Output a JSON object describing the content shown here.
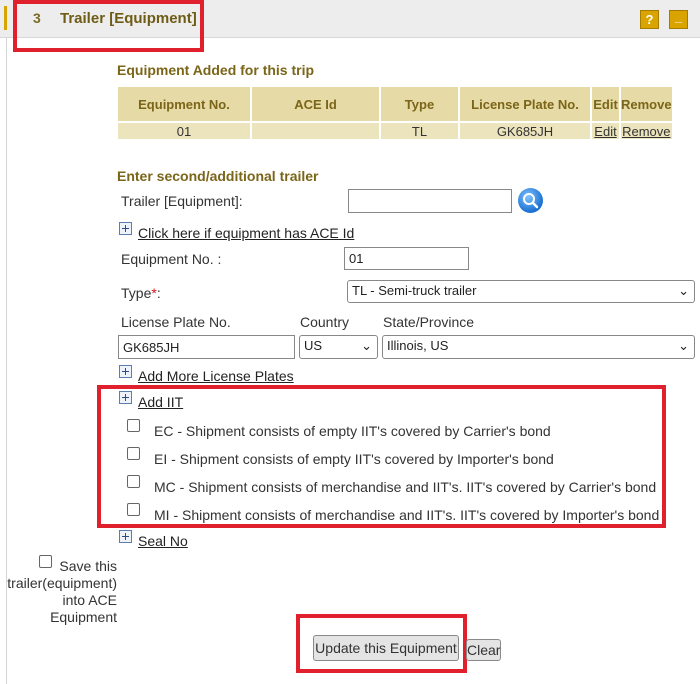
{
  "header": {
    "number": "3",
    "title": "Trailer [Equipment]",
    "help_label": "?",
    "minimize_label": "_"
  },
  "equipment_added": {
    "title": "Equipment Added for this trip",
    "columns": [
      "Equipment No.",
      "ACE Id",
      "Type",
      "License Plate No.",
      "Edit",
      "Remove"
    ],
    "rows": [
      {
        "equipment_no": "01",
        "ace_id": "",
        "type": "TL",
        "license_plate": "GK685JH",
        "edit": "Edit",
        "remove": "Remove"
      }
    ]
  },
  "form": {
    "title": "Enter second/additional trailer",
    "trailer_label": "Trailer [Equipment]:",
    "trailer_value": "",
    "ace_link": "Click here if equipment has ACE Id",
    "equipment_no_label": "Equipment No. :",
    "equipment_no_value": "01",
    "type_label": "Type",
    "required_mark": "*",
    "type_colon": ":",
    "type_value": "TL - Semi-truck trailer",
    "plate_label": "License Plate No.",
    "country_label": "Country",
    "state_label": "State/Province",
    "plate_value": "GK685JH",
    "country_value": "US",
    "state_value": "Illinois, US",
    "add_plates_link": "Add More License Plates",
    "add_iit_link": "Add IIT",
    "iit_options": [
      "EC - Shipment consists of empty IIT's covered by Carrier's bond",
      "EI - Shipment consists of empty IIT's covered by Importer's bond",
      "MC - Shipment consists of merchandise and IIT's. IIT's covered by Carrier's bond",
      "MI - Shipment consists of merchandise and IIT's. IIT's covered by Importer's bond"
    ],
    "seal_link": "Seal No",
    "save_label_lines": [
      "Save this",
      "trailer(equipment)",
      "into ACE",
      "Equipment"
    ],
    "update_button": "Update this Equipment",
    "clear_button": "Clear"
  }
}
